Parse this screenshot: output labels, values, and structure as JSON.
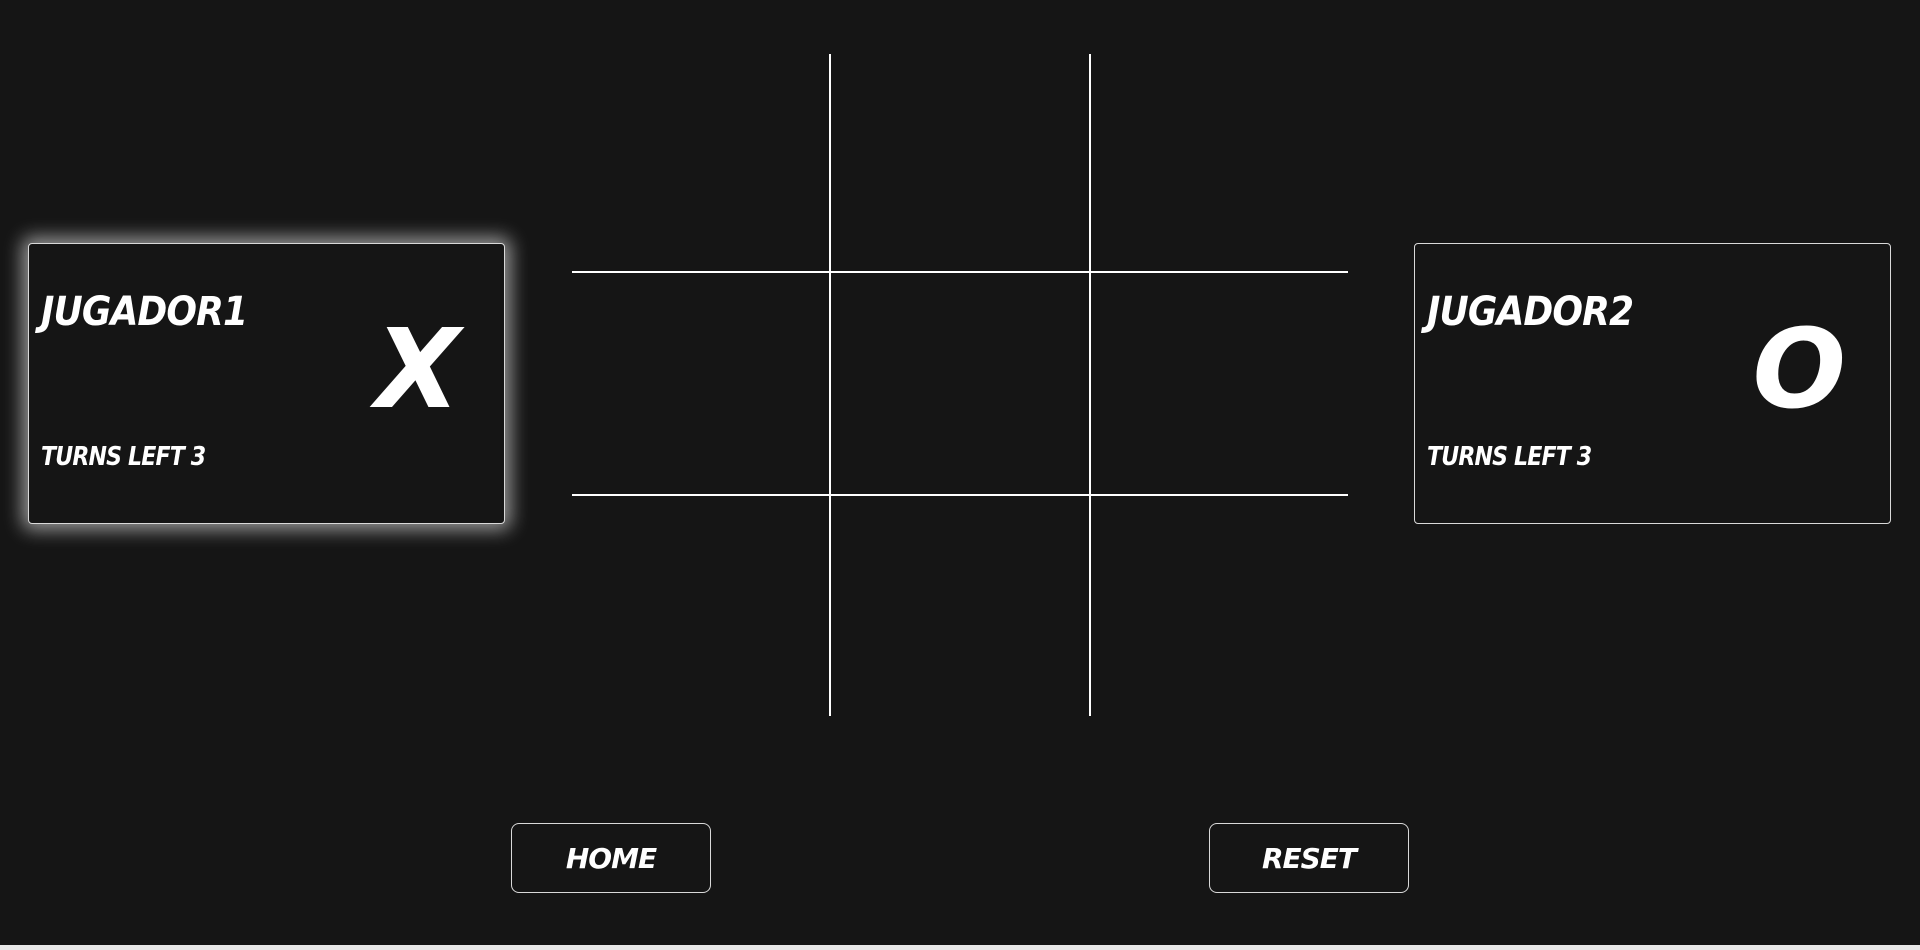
{
  "player1": {
    "name": "JUGADOR1",
    "turns_label": "TURNS LEFT",
    "turns_left": "3",
    "mark": "X",
    "active": true
  },
  "player2": {
    "name": "JUGADOR2",
    "turns_label": "TURNS LEFT",
    "turns_left": "3",
    "mark": "O",
    "active": false
  },
  "board": {
    "cells": [
      "",
      "",
      "",
      "",
      "",
      "",
      "",
      "",
      ""
    ]
  },
  "buttons": {
    "home_label": "HOME",
    "reset_label": "RESET"
  },
  "colors": {
    "background": "#151515",
    "foreground": "#ffffff",
    "border": "#d9d9d9",
    "active_glow": "rgba(255,255,255,0.55)"
  }
}
